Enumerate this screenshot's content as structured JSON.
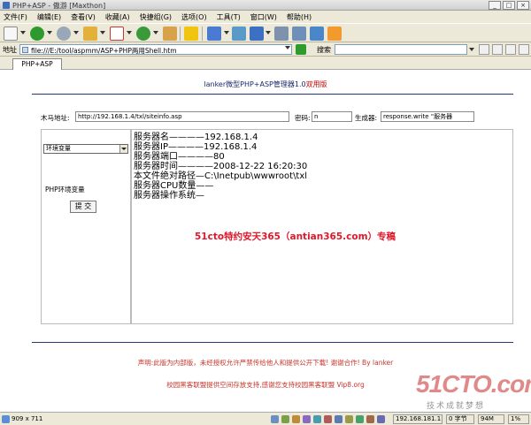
{
  "window": {
    "title": "PHP+ASP - 傲游 [Maxthon]",
    "buttons": {
      "minimize": "_",
      "maximize": "□",
      "close": "×"
    }
  },
  "menu": [
    "文件(F)",
    "编辑(E)",
    "查看(V)",
    "收藏(A)",
    "快捷组(G)",
    "选项(O)",
    "工具(T)",
    "窗口(W)",
    "帮助(H)"
  ],
  "address": {
    "label": "地址",
    "url": "file:///E:/tool/aspmm/ASP+PHP两用Shell.htm"
  },
  "search": {
    "label": "搜索",
    "value": ""
  },
  "tabs": [
    {
      "label": "PHP+ASP"
    }
  ],
  "page": {
    "title": "lanker微型PHP+ASP管理器1.0",
    "title_tag": "双用版",
    "trojan_label": "木马地址:",
    "trojan_url": "http://192.168.1.4/txl/siteinfo.asp",
    "password_label": "密码:",
    "password_value": "n",
    "generator_label": "生成器:",
    "generator_value": "response.write \"服务器",
    "env_select": "环境变量",
    "php_env_label": "PHP环境变量",
    "submit_label": "提 交",
    "info_lines": [
      "服务器名————192.168.1.4",
      "服务器IP————192.168.1.4",
      "服务器端口————80",
      "服务器时间————2008-12-22 16:20:30",
      "本文件绝对路径—C:\\Inetpub\\wwwroot\\txl",
      "服务器CPU数量——",
      "服务器操作系统—"
    ],
    "promo": "51cto特约安天365（antian365.com）专稿",
    "notice1": "声明:此版为内部版，未经授权允许严禁传给他人和提供公开下载! 谢谢合作! By lanker",
    "notice2": "校园黑客联盟提供空间存放支持,感谢您支持校园黑客联盟",
    "notice2_link": "Vip8.org"
  },
  "watermark": {
    "logo": "51CTO.com",
    "slogan": "技术成就梦想"
  },
  "status": {
    "dimensions": "909 x 711",
    "ip": "192.168.181.1",
    "bytes": "0 字节",
    "memory": "94M",
    "progress_label": "1%"
  },
  "colors": {
    "page_title": "#1b2a6a",
    "title_tag": "#cc0000",
    "promo": "#e0182b",
    "notice": "#c8342a",
    "divider": "#233a7a"
  }
}
